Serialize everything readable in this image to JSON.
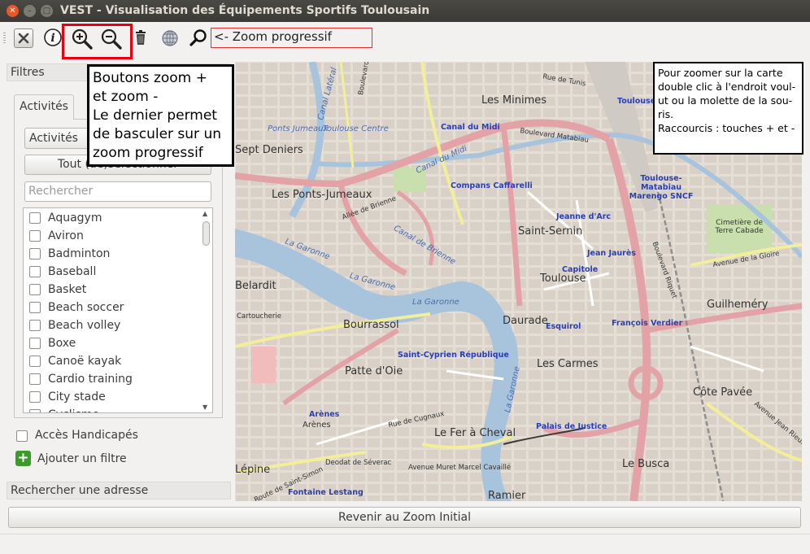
{
  "window": {
    "title": "VEST - Visualisation des Équipements Sportifs Toulousain"
  },
  "toolbar": {
    "close_icon": "x-square-icon",
    "info_icon": "info-icon",
    "zoom_in_icon": "zoom-in-icon",
    "zoom_out_icon": "zoom-out-icon",
    "trash_icon": "trash-icon",
    "globe_icon": "globe-icon",
    "progressive_zoom_icon": "magnifier-icon",
    "progressive_zoom_label": "<- Zoom progressif"
  },
  "sidebar": {
    "filters_header": "Filtres",
    "tab_label": "Activités",
    "combo_value": "Activités",
    "toggle_button": "Tout (dé)sélectionner",
    "search_placeholder": "Rechercher",
    "items": [
      "Aquagym",
      "Aviron",
      "Badminton",
      "Baseball",
      "Basket",
      "Beach soccer",
      "Beach volley",
      "Boxe",
      "Canoë kayak",
      "Cardio training",
      "City stade",
      "Cyclisme"
    ],
    "accessibility_label": "Accès Handicapés",
    "add_filter_label": "Ajouter un filtre",
    "address_header": "Rechercher une adresse"
  },
  "annotations": {
    "zoom_buttons": "Boutons zoom +\net zoom -\nLe dernier permet\nde basculer sur un\nzoom progressif",
    "map_help": "Pour zoomer sur la carte double clic à l'endroit voul-ut ou la molette de la sou-ris.\nRaccourcis : touches + et -"
  },
  "map": {
    "districts": [
      "Les Minimes",
      "Les Ponts-Jumeaux",
      "Sept Deniers",
      "Saint-Sernin",
      "Toulouse",
      "Bourrassol",
      "Daurade",
      "Patte d'Oie",
      "Les Carmes",
      "Côte Pavée",
      "Guilheméry",
      "Le Fer à Cheval",
      "Le Busca",
      "Cimetière de Terre Cabade",
      "Ramier",
      "Arènes",
      "Lépine",
      "Belardit"
    ],
    "stations": [
      "Canal du Midi",
      "Compans Caffarelli",
      "Jeanne d'Arc",
      "Jean Jaurès",
      "Capitole",
      "Esquirol",
      "François Verdier",
      "Saint-Cyprien République",
      "Palais de Justice",
      "Toulouse-Matabiau Marengo SNCF",
      "Fontaine Lestang",
      "Arènes",
      "Toulouse-Ra"
    ],
    "roads": [
      "Boulevard de Suisse",
      "Canal Latéral",
      "Ponts Jumeaux",
      "Toulouse Centre",
      "Allée de Brienne",
      "Canal de Brienne",
      "Boulevard Matabiau",
      "Rue de Tunis",
      "Avenue de la Gloire",
      "Rue de Cugnaux",
      "Route de Saint-Simon",
      "Avenue Jean Rieux",
      "Avenue Muret Marcel Cavaillé",
      "Deodat de Séverac",
      "Cartoucherie",
      "Boulevard Riquet",
      "Canal du Midi"
    ],
    "rivers": [
      "La Garonne",
      "La Garonne",
      "La Garonne",
      "La Garonne"
    ]
  },
  "bottom": {
    "reset_zoom": "Revenir au Zoom Initial"
  }
}
